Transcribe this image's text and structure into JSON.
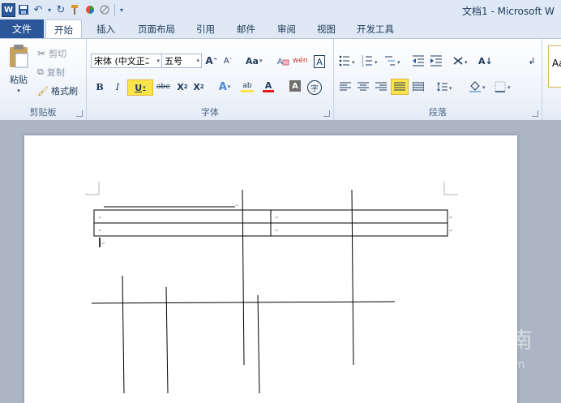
{
  "window": {
    "title": "文档1 - Microsoft W"
  },
  "qat": {
    "logo": "W",
    "save": "💾",
    "undo": "↶",
    "undo_more": "▾",
    "redo": "↻",
    "separator": "|",
    "customize": "▾"
  },
  "tabs": {
    "file": "文件",
    "home": "开始",
    "insert": "插入",
    "layout": "页面布局",
    "references": "引用",
    "mailings": "邮件",
    "review": "审阅",
    "view": "视图",
    "developer": "开发工具"
  },
  "clipboard": {
    "paste": "粘贴",
    "cut": "剪切",
    "copy": "复制",
    "format_painter": "格式刷",
    "group_label": "剪贴板"
  },
  "font": {
    "font_name": "宋体 (中文正ﾆ",
    "font_size": "五号",
    "grow": "A",
    "shrink": "A",
    "change_case": "Aa",
    "clear_format": "¶",
    "phonetic": "wén",
    "border_char": "A",
    "bold": "B",
    "italic": "I",
    "underline": "U",
    "strikethrough": "abe",
    "subscript": "X",
    "superscript": "X",
    "text_effects": "A",
    "highlight": "ab",
    "font_color": "A",
    "char_shading": "A",
    "enclose": "字",
    "group_label": "字体"
  },
  "paragraph": {
    "group_label": "段落",
    "sort": "A↓",
    "show_marks": "↲"
  },
  "styles": {
    "preview": "Aa"
  },
  "document": {
    "cursor": "|"
  },
  "watermark": {
    "text": "搜狗指南",
    "url": "zhinan.sogou.com"
  },
  "colors": {
    "accent": "#2b579a",
    "ribbon_bg": "#eef3fa",
    "workspace": "#abb5c3",
    "highlight": "#fbe34a",
    "font_red": "#e01e1e"
  }
}
